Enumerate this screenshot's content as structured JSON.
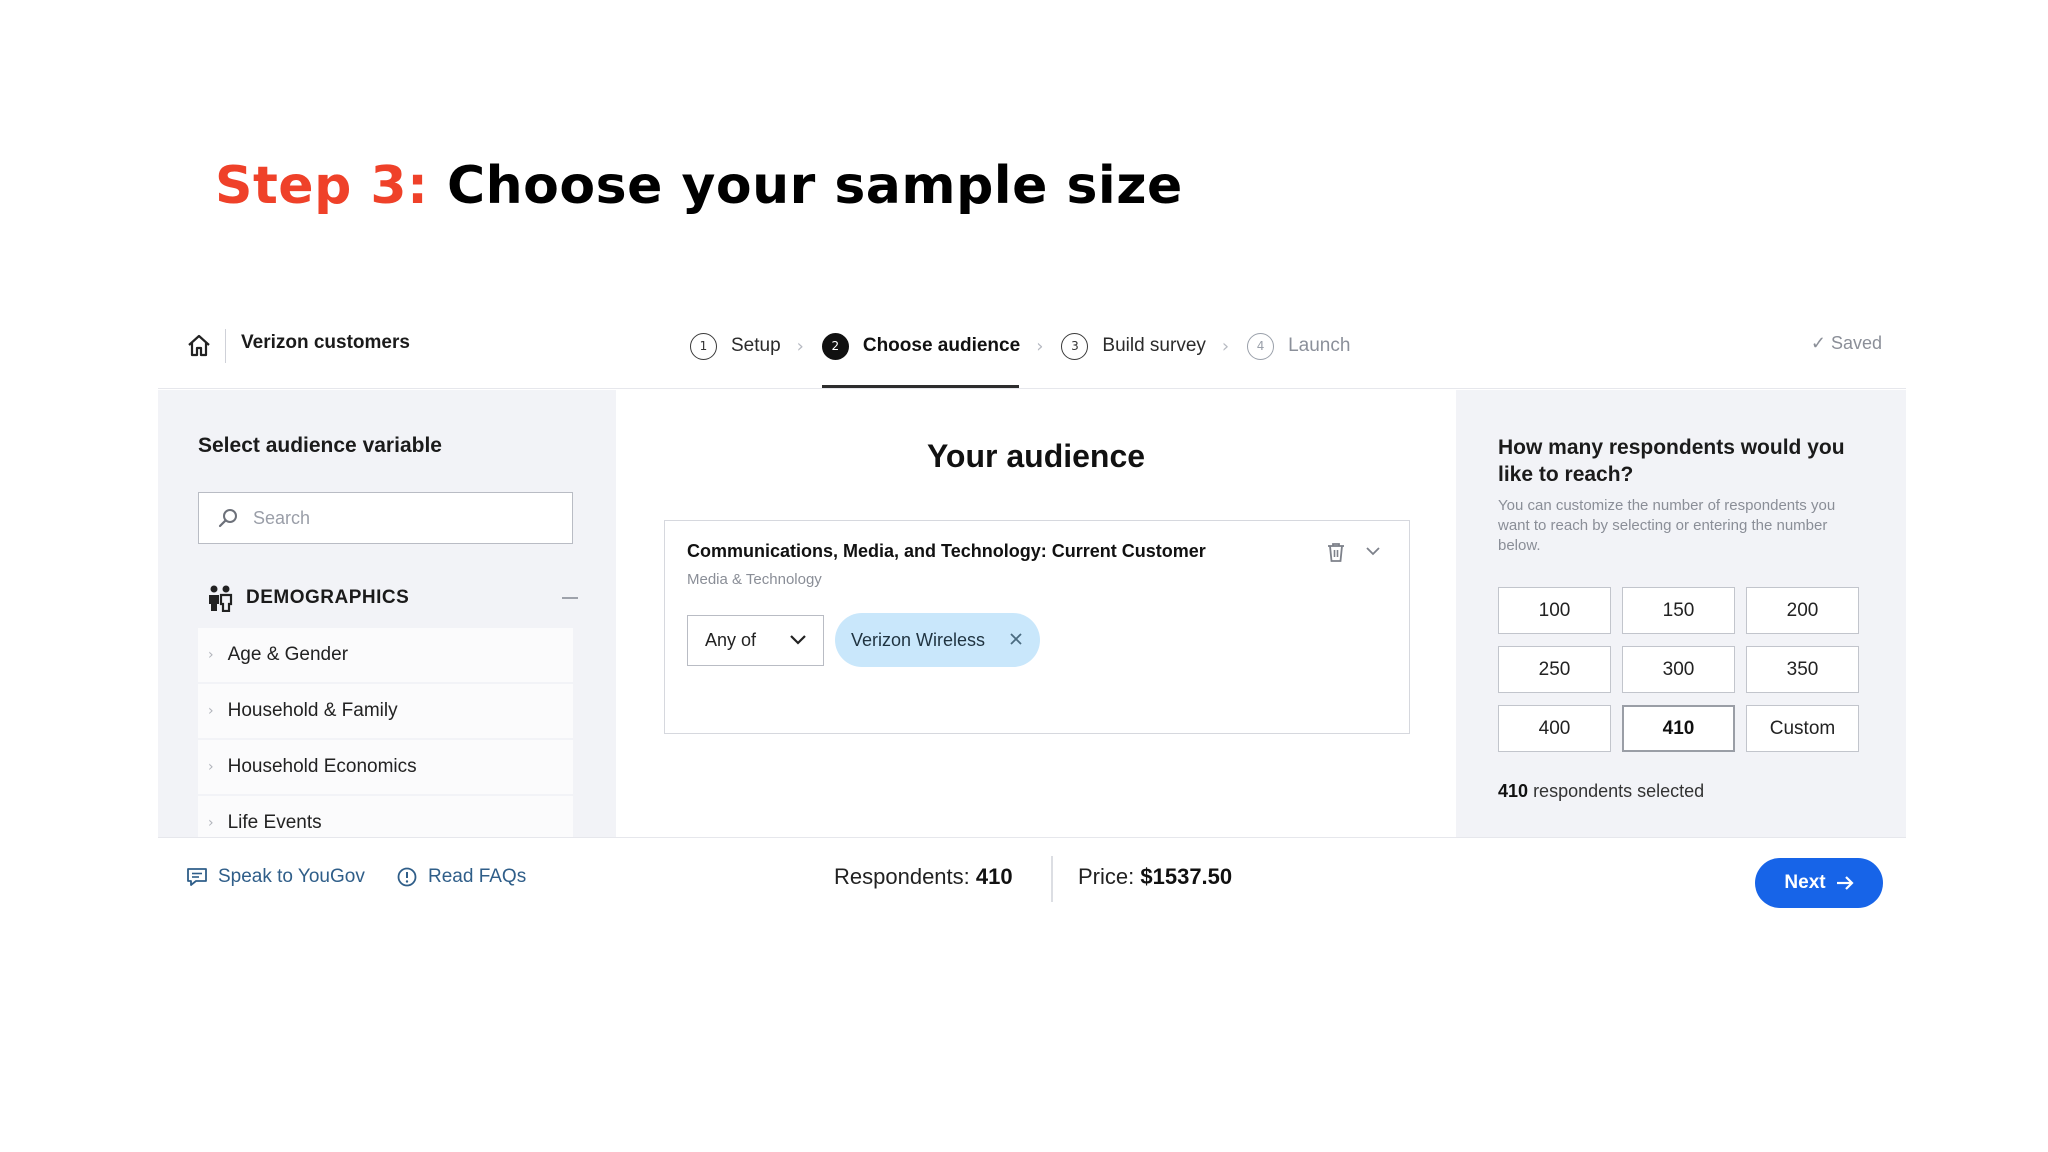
{
  "slide": {
    "step_prefix": "Step 3:",
    "step_title": "Choose your sample size"
  },
  "header": {
    "project_title": "Verizon customers",
    "steps": [
      {
        "number": "1",
        "label": "Setup"
      },
      {
        "number": "2",
        "label": "Choose audience"
      },
      {
        "number": "3",
        "label": "Build survey"
      },
      {
        "number": "4",
        "label": "Launch"
      }
    ],
    "saved_label": "Saved"
  },
  "sidebar": {
    "heading": "Select audience variable",
    "search_placeholder": "Search",
    "category": "DEMOGRAPHICS",
    "items": [
      "Age & Gender",
      "Household & Family",
      "Household Economics",
      "Life Events"
    ]
  },
  "audience": {
    "heading": "Your audience",
    "card_title": "Communications, Media, and Technology: Current Customer",
    "card_subtitle": "Media & Technology",
    "operator": "Any of",
    "chip": "Verizon Wireless"
  },
  "respondents_panel": {
    "heading": "How many respondents would you like to reach?",
    "description": "You can customize the number of respondents you want to reach by selecting or entering the number below.",
    "options": [
      "100",
      "150",
      "200",
      "250",
      "300",
      "350",
      "400",
      "410",
      "Custom"
    ],
    "selected": "410",
    "selected_suffix": "respondents selected"
  },
  "footer": {
    "speak_label": "Speak to YouGov",
    "faq_label": "Read FAQs",
    "respondents_label": "Respondents:",
    "respondents_value": "410",
    "price_label": "Price:",
    "price_value": "$1537.50",
    "next_label": "Next"
  },
  "colors": {
    "step_accent": "#ef4129",
    "primary_button": "#1764e8",
    "chip_bg": "#c9e7fb",
    "link": "#2f5e89",
    "panel_bg": "#f2f3f7"
  }
}
